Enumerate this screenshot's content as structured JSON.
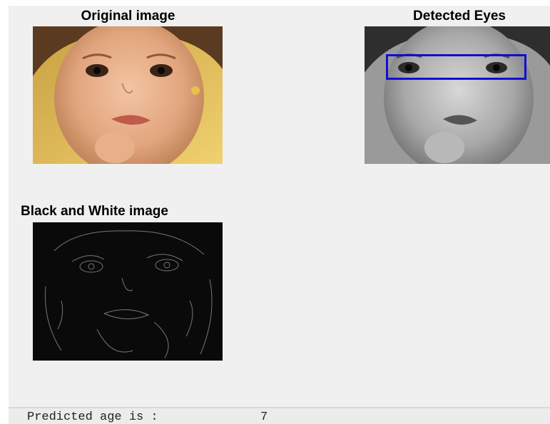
{
  "panels": {
    "original": {
      "title": "Original image"
    },
    "detected": {
      "title": "Detected Eyes"
    },
    "bw": {
      "title": "Black and White image"
    }
  },
  "status": {
    "label": "Predicted age is :",
    "value": "7"
  },
  "colors": {
    "figure_background": "#f0f0f0",
    "detection_box": "#1010d0"
  }
}
